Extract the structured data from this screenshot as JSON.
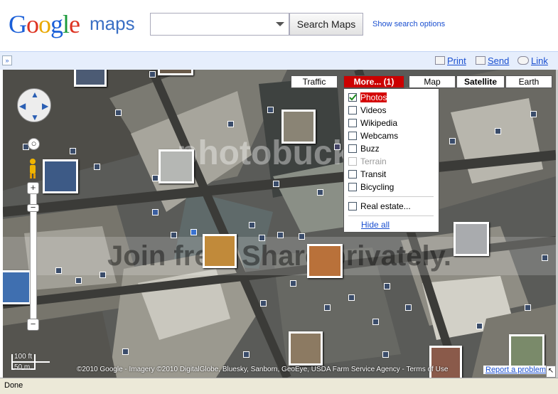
{
  "header": {
    "logo_text": "Google",
    "logo_suffix": "maps",
    "search_value": "",
    "search_button": "Search Maps",
    "search_options": "Show search options"
  },
  "toolbar": {
    "collapse_label": "»",
    "print": "Print",
    "send": "Send",
    "link": "Link"
  },
  "map": {
    "type_buttons": [
      "Traffic",
      "More... (1)",
      "Map",
      "Satellite",
      "Earth"
    ],
    "selected_type": "Satellite",
    "more_menu": {
      "items": [
        {
          "label": "Photos",
          "checked": true,
          "disabled": false
        },
        {
          "label": "Videos",
          "checked": false,
          "disabled": false
        },
        {
          "label": "Wikipedia",
          "checked": false,
          "disabled": false
        },
        {
          "label": "Webcams",
          "checked": false,
          "disabled": false
        },
        {
          "label": "Buzz",
          "checked": false,
          "disabled": false
        },
        {
          "label": "Terrain",
          "checked": false,
          "disabled": true
        },
        {
          "label": "Transit",
          "checked": false,
          "disabled": false
        },
        {
          "label": "Bicycling",
          "checked": false,
          "disabled": false
        },
        {
          "label": "Real estate...",
          "checked": false,
          "disabled": false
        }
      ],
      "hide_all": "Hide all"
    },
    "zoom_plus": "+",
    "zoom_minus": "−",
    "scale_ft": "100 ft",
    "scale_m": "50 m",
    "copyright": "©2010 Google - Imagery ©2010 DigitalGlobe, Bluesky, Sanborn, GeoEye, USDA Farm Service Agency - Terms of Use",
    "report_problem": "Report a problem",
    "watermark_top": "photobucket",
    "watermark_bottom": "Join free. Share privately."
  },
  "statusbar": {
    "text": "Done"
  },
  "colors": {
    "accent_red": "#cc0000",
    "link_blue": "#1a4fd0",
    "toolbar_bg": "#e6eefc"
  }
}
